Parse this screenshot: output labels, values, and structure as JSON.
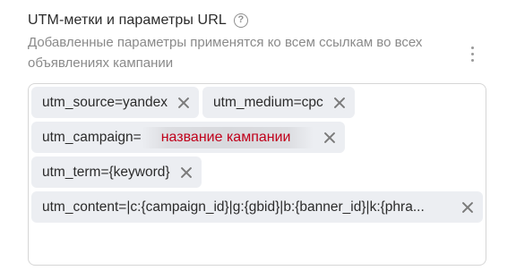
{
  "section": {
    "title": "UTM-метки и параметры URL",
    "help_icon": "question-circle-icon",
    "subtitle": "Добавленные параметры применятся ко всем ссылкам во всех объявлениях кампании",
    "more_icon": "vertical-dots-icon"
  },
  "tags": [
    {
      "label": "utm_source=yandex"
    },
    {
      "label": "utm_medium=cpc"
    },
    {
      "label": "utm_campaign=",
      "redacted_value": "название кампании"
    },
    {
      "label": "utm_term={keyword}"
    },
    {
      "label": "utm_content=|c:{campaign_id}|g:{gbid}|b:{banner_id}|k:{phra..."
    }
  ],
  "colors": {
    "tag_bg": "#eceef2",
    "redact_text": "#c0001a",
    "border": "#d6d6d6",
    "muted_text": "#8a8a8a"
  }
}
